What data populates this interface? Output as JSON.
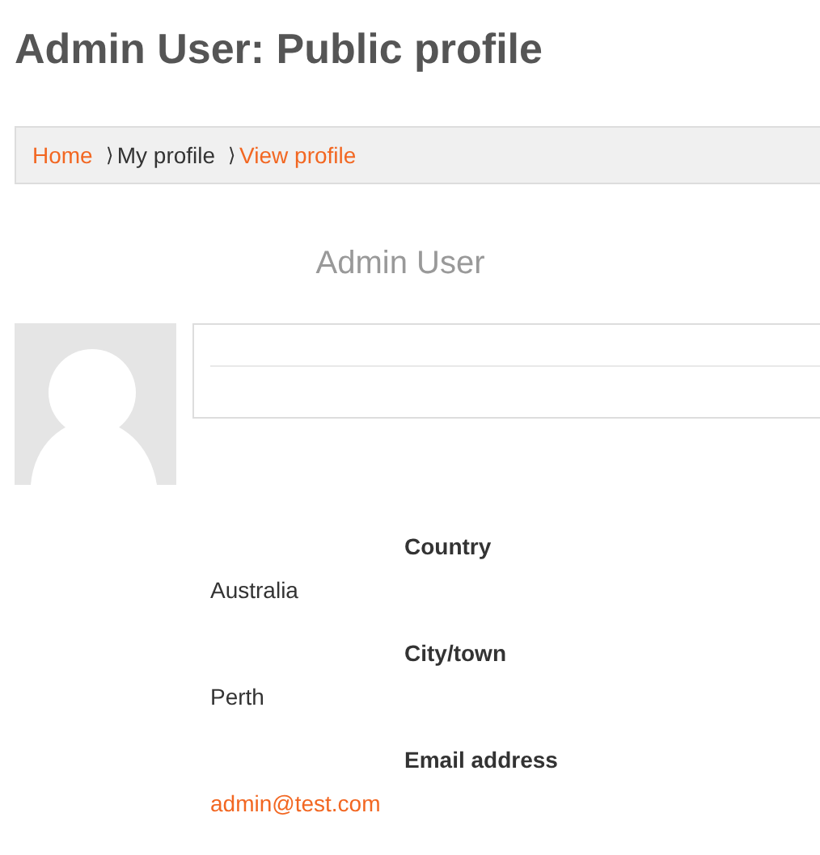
{
  "page_title": "Admin User: Public profile",
  "breadcrumb": [
    {
      "kind": "link",
      "label": "Home"
    },
    {
      "kind": "separator",
      "label": "⟩"
    },
    {
      "kind": "text",
      "label": "My profile"
    },
    {
      "kind": "separator",
      "label": "⟩"
    },
    {
      "kind": "link",
      "label": "View profile"
    }
  ],
  "user_name": "Admin User",
  "fields": [
    {
      "label": "Country",
      "value": "Australia",
      "kind": "text"
    },
    {
      "label": "City/town",
      "value": "Perth",
      "kind": "text"
    },
    {
      "label": "Email address",
      "value": "admin@test.com",
      "kind": "link"
    }
  ]
}
